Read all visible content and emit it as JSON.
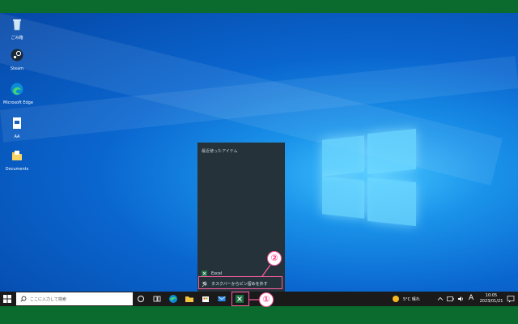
{
  "desktop": {
    "icons": [
      {
        "label": "ごみ箱",
        "icon": "recycle-bin-icon"
      },
      {
        "label": "Steam",
        "icon": "steam-icon"
      },
      {
        "label": "Microsoft Edge",
        "icon": "edge-icon"
      },
      {
        "label": "AA",
        "icon": "document-icon"
      },
      {
        "label": "Documents",
        "icon": "folder-icon"
      }
    ]
  },
  "jumplist": {
    "heading": "最近使ったアイテム",
    "app_item": "Excel",
    "unpin_item": "タスクバーからピン留めを外す"
  },
  "taskbar": {
    "search_placeholder": "ここに入力して検索",
    "weather": "5°C 晴れ",
    "ime": "A",
    "time": "10:05",
    "date": "2023/01/21"
  },
  "callouts": {
    "one": "①",
    "two": "②"
  },
  "colors": {
    "callout": "#ff5fa2",
    "excel": "#1d7044",
    "taskbar": "#1a1a1a",
    "jumplist": "#25323a"
  }
}
